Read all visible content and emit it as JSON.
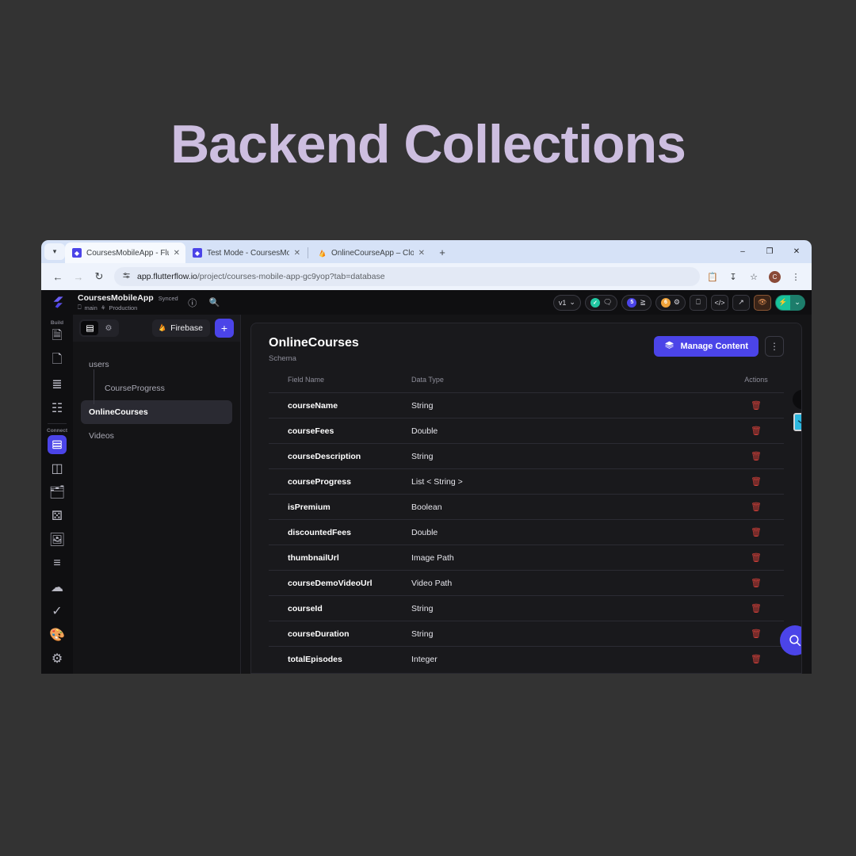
{
  "poster": {
    "title": "Backend Collections"
  },
  "browser": {
    "tabs": [
      {
        "label": "CoursesMobileApp - FlutterFlow",
        "favicon": "flutterflow-icon",
        "active": true
      },
      {
        "label": "Test Mode - CoursesMobileApp",
        "favicon": "flutterflow-icon",
        "active": false
      },
      {
        "label": "OnlineCourseApp – Cloud Fires",
        "favicon": "firebase-icon",
        "active": false
      }
    ],
    "new_tab_label": "+",
    "window_controls": {
      "minimize": "–",
      "maximize": "❐",
      "close": "✕"
    },
    "address": {
      "url_bold": "app.flutterflow.io",
      "url_rest": "/project/courses-mobile-app-gc9yop?tab=database",
      "back": "←",
      "forward": "→",
      "reload": "↻",
      "tune_icon": "site-settings-icon"
    },
    "toolbar_icons": [
      "clipboard-icon",
      "install-icon",
      "bookmark-star-icon"
    ],
    "profile_initial": "C",
    "menu_icon": "⋮"
  },
  "app": {
    "logo": "flutterflow-logo",
    "project_name": "CoursesMobileApp",
    "sync_status": "Synced",
    "branch": "main",
    "environment": "Production",
    "help_icon": "help-circle-icon",
    "search_icon": "search-icon",
    "toolbar": {
      "version_label": "v1",
      "version_caret": "⌄",
      "check_badge": "✓",
      "comment_icon": "comment-icon",
      "issues_count": "5",
      "issues_icon": "lightning-list-icon",
      "warnings_count": "6",
      "warnings_icon": "bug-icon",
      "branch_icon": "branch-icon",
      "code_icon": "</>",
      "share_icon": "external-link-icon",
      "preview_icon": "eye-icon",
      "run_icon": "⚡",
      "run_caret": "⌄"
    }
  },
  "collections_panel": {
    "segment": {
      "database_icon": "database-icon",
      "settings_icon": "gear-icon"
    },
    "firebase_label": "Firebase",
    "firebase_icon": "firebase-flame-icon",
    "add_label": "+",
    "items": [
      {
        "label": "users",
        "indent": false,
        "selected": false
      },
      {
        "label": "CourseProgress",
        "indent": true,
        "selected": false
      },
      {
        "label": "OnlineCourses",
        "indent": false,
        "selected": true
      },
      {
        "label": "Videos",
        "indent": false,
        "selected": false
      }
    ]
  },
  "main": {
    "title": "OnlineCourses",
    "subtitle": "Schema",
    "manage_content_label": "Manage Content",
    "manage_content_icon": "layers-icon",
    "kebab_icon": "⋮",
    "table": {
      "headers": {
        "field_name": "Field Name",
        "data_type": "Data Type",
        "actions": "Actions"
      },
      "rows": [
        {
          "field": "courseName",
          "type": "String"
        },
        {
          "field": "courseFees",
          "type": "Double"
        },
        {
          "field": "courseDescription",
          "type": "String"
        },
        {
          "field": "courseProgress",
          "type": "List < String >"
        },
        {
          "field": "isPremium",
          "type": "Boolean"
        },
        {
          "field": "discountedFees",
          "type": "Double"
        },
        {
          "field": "thumbnailUrl",
          "type": "Image Path"
        },
        {
          "field": "courseDemoVideoUrl",
          "type": "Video Path"
        },
        {
          "field": "courseId",
          "type": "String"
        },
        {
          "field": "courseDuration",
          "type": "String"
        },
        {
          "field": "totalEpisodes",
          "type": "Integer"
        }
      ],
      "delete_icon": "trash-icon"
    },
    "floating": {
      "search_fab_icon": "search-icon",
      "pen_badge_icon": "pen-nib-icon",
      "cyan_badge_icon": "smile-icon"
    }
  },
  "rail": {
    "sections": [
      {
        "label": "Build",
        "items": [
          "add-page-icon",
          "pages-icon",
          "components-icon",
          "widget-tree-icon"
        ]
      },
      {
        "label": "Connect",
        "items": [
          "database-icon",
          "api-icon",
          "local-state-icon",
          "integrations-icon",
          "media-icon",
          "logs-icon",
          "cloud-icon",
          "tests-icon",
          "theme-icon",
          "settings-icon"
        ]
      }
    ]
  },
  "colors": {
    "accent_purple": "#4b44e8",
    "poster_title": "#cdbee0",
    "poster_bg": "#333333",
    "panel_bg": "#19191c",
    "delete_red": "#d5403a",
    "run_teal": "#18c39a"
  }
}
